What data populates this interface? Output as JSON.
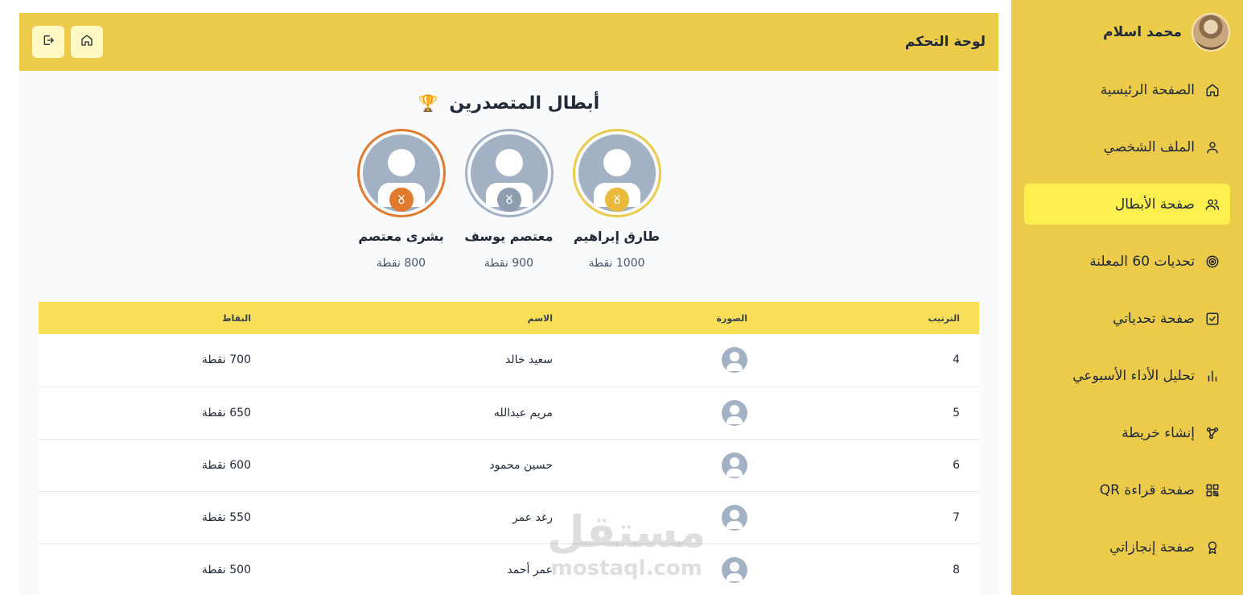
{
  "sidebar": {
    "user_name": "محمد اسلام",
    "items": [
      {
        "label": "الصفحة الرئيسية",
        "icon": "home-icon"
      },
      {
        "label": "الملف الشخصي",
        "icon": "user-icon"
      },
      {
        "label": "صفحة الأبطال",
        "icon": "users-icon",
        "active": true
      },
      {
        "label": "تحديات 60 المعلنة",
        "icon": "target-icon"
      },
      {
        "label": "صفحة تحدياتي",
        "icon": "check-square-icon"
      },
      {
        "label": "تحليل الأداء الأسبوعي",
        "icon": "bar-chart-icon"
      },
      {
        "label": "إنشاء خريطة",
        "icon": "share-nodes-icon"
      },
      {
        "label": "صفحة قراءة QR",
        "icon": "qr-code-icon"
      },
      {
        "label": "صفحة إنجازاتي",
        "icon": "award-icon"
      }
    ]
  },
  "header": {
    "title": "لوحة التحكم",
    "home_icon": "home-icon",
    "logout_icon": "logout-icon"
  },
  "leaders": {
    "title": "أبطال المتصدرين",
    "trophy": "🏆",
    "podium": [
      {
        "name": "طارق إبراهيم",
        "points": "1000 نقطة",
        "ring_color": "#eccb4b",
        "medal_color": "#eab83a"
      },
      {
        "name": "معتصم يوسف",
        "points": "900 نقطة",
        "ring_color": "#a3b1c4",
        "medal_color": "#8f9db1"
      },
      {
        "name": "بشرى معتصم",
        "points": "800 نقطة",
        "ring_color": "#e07a2f",
        "medal_color": "#e07a2f"
      }
    ]
  },
  "table": {
    "headers": [
      "الترتيب",
      "الصورة",
      "الاسم",
      "النقاط"
    ],
    "rows": [
      {
        "rank": "4",
        "name": "سعيد خالد",
        "points": "700 نقطة"
      },
      {
        "rank": "5",
        "name": "مريم عبدالله",
        "points": "650 نقطة"
      },
      {
        "rank": "6",
        "name": "حسين محمود",
        "points": "600 نقطة"
      },
      {
        "rank": "7",
        "name": "رغد عمر",
        "points": "550 نقطة"
      },
      {
        "rank": "8",
        "name": "عمر أحمد",
        "points": "500 نقطة"
      }
    ]
  },
  "watermark": {
    "arabic": "مستقل",
    "latin": "mostaql.com"
  },
  "colors": {
    "accent": "#eccb4b",
    "active": "#fdf04e",
    "table_header": "#f9df58"
  }
}
